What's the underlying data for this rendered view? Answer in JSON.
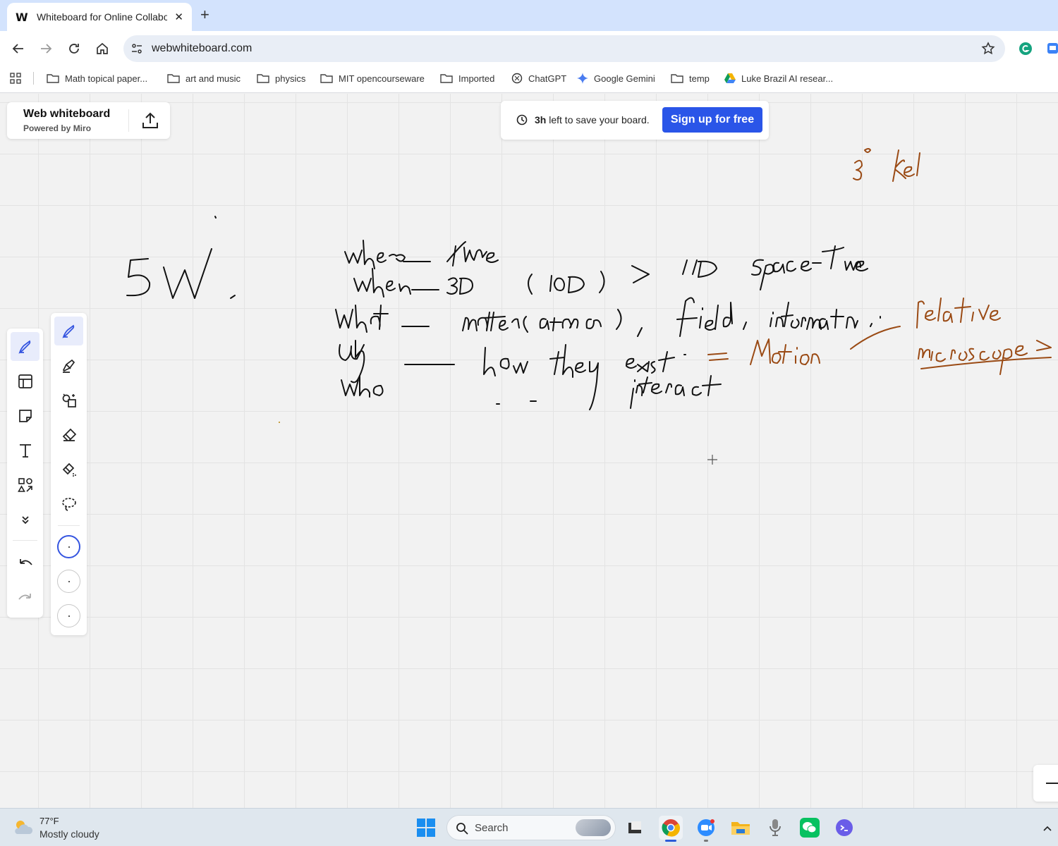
{
  "browser": {
    "tab": {
      "favicon": "W",
      "title": "Whiteboard for Online Collabor",
      "close": "✕"
    },
    "new_tab": "+",
    "url": "webwhiteboard.com",
    "bookmarks": [
      {
        "label": "Math topical paper...",
        "icon": "folder-icon"
      },
      {
        "label": "art and music",
        "icon": "folder-icon"
      },
      {
        "label": "physics",
        "icon": "folder-icon"
      },
      {
        "label": "MIT opencourseware",
        "icon": "folder-icon"
      },
      {
        "label": "Imported",
        "icon": "folder-icon"
      },
      {
        "label": "ChatGPT",
        "icon": "chatgpt-icon"
      },
      {
        "label": "Google Gemini",
        "icon": "gemini-icon"
      },
      {
        "label": "temp",
        "icon": "folder-icon"
      },
      {
        "label": "Luke Brazil AI resear...",
        "icon": "google-drive-icon"
      }
    ]
  },
  "board": {
    "brand": {
      "title": "Web whiteboard",
      "subtitle": "Powered by Miro"
    },
    "banner": {
      "hours": "3h",
      "message": " left to save your board.",
      "cta": "Sign up for free"
    },
    "left_tools": [
      "pen-icon",
      "layout-frame-icon",
      "sticky-note-icon",
      "text-icon",
      "shapes-icon",
      "more-tools-icon",
      "undo-icon",
      "redo-icon"
    ],
    "pen_tools": [
      "pen-icon",
      "highlighter-icon",
      "smart-draw-icon",
      "eraser-icon",
      "object-eraser-icon",
      "lasso-icon"
    ],
    "stroke_sizes": [
      "thin",
      "medium",
      "thick"
    ],
    "selected_stroke_size": "thin",
    "colors": {
      "ink_black": "#111111",
      "ink_brown": "#9a4a14",
      "accent": "#2a55e8"
    }
  },
  "taskbar": {
    "weather": {
      "temp": "77°F",
      "condition": "Mostly cloudy"
    },
    "search_label": "Search",
    "apps": [
      "file-explorer-app",
      "chrome-app",
      "zoom-app",
      "folder-app",
      "microphone-app",
      "wechat-app",
      "terminal-app"
    ]
  }
}
